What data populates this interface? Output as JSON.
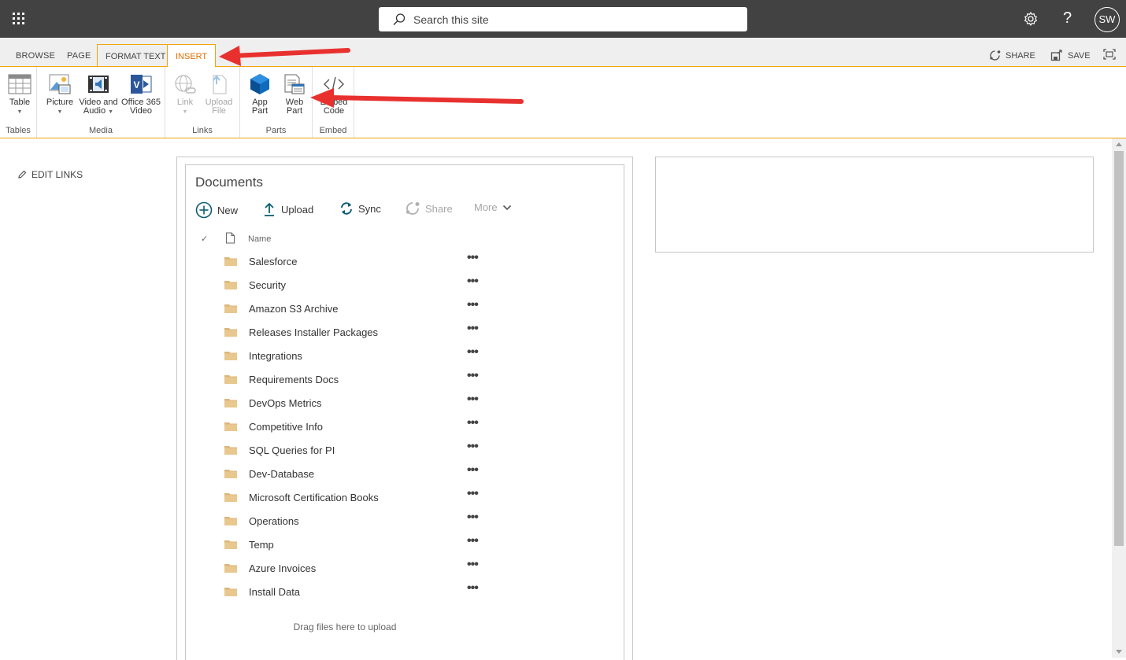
{
  "suitebar": {
    "search_placeholder": "Search this site",
    "user_initials": "SW",
    "help_glyph": "?"
  },
  "ribbon_tabs": {
    "browse": "BROWSE",
    "page": "PAGE",
    "format_text": "FORMAT TEXT",
    "insert": "INSERT",
    "share": "SHARE",
    "save": "SAVE"
  },
  "ribbon": {
    "tables_group": "Tables",
    "media_group": "Media",
    "links_group": "Links",
    "parts_group": "Parts",
    "embed_group": "Embed",
    "table": "Table",
    "picture": "Picture",
    "video_audio_1": "Video and",
    "video_audio_2": "Audio",
    "o365_1": "Office 365",
    "o365_2": "Video",
    "link": "Link",
    "upload_1": "Upload",
    "upload_2": "File",
    "app_1": "App",
    "app_2": "Part",
    "web_1": "Web",
    "web_2": "Part",
    "embed_1": "Embed",
    "embed_2": "Code"
  },
  "leftnav": {
    "edit_links": "EDIT LINKS"
  },
  "documents": {
    "title": "Documents",
    "commands": {
      "new": "New",
      "upload": "Upload",
      "sync": "Sync",
      "share": "Share",
      "more": "More"
    },
    "header_name": "Name",
    "folders": [
      "Salesforce",
      "Security",
      "Amazon S3 Archive",
      "Releases Installer Packages",
      "Integrations",
      "Requirements Docs",
      "DevOps Metrics",
      "Competitive Info",
      "SQL Queries for PI",
      "Dev-Database",
      "Microsoft Certification Books",
      "Operations",
      "Temp",
      "Azure Invoices",
      "Install Data"
    ],
    "ellipsis": "•••",
    "drag_text": "Drag files here to upload"
  },
  "colors": {
    "accent": "#f0a30a",
    "suitebar": "#424242",
    "folder": "#dcb67a",
    "annotation": "#e8312f"
  },
  "icons": [
    "waffle-icon",
    "search-icon",
    "gear-icon",
    "share-icon",
    "save-icon",
    "focus-icon",
    "pencil-icon",
    "folder-icon"
  ]
}
